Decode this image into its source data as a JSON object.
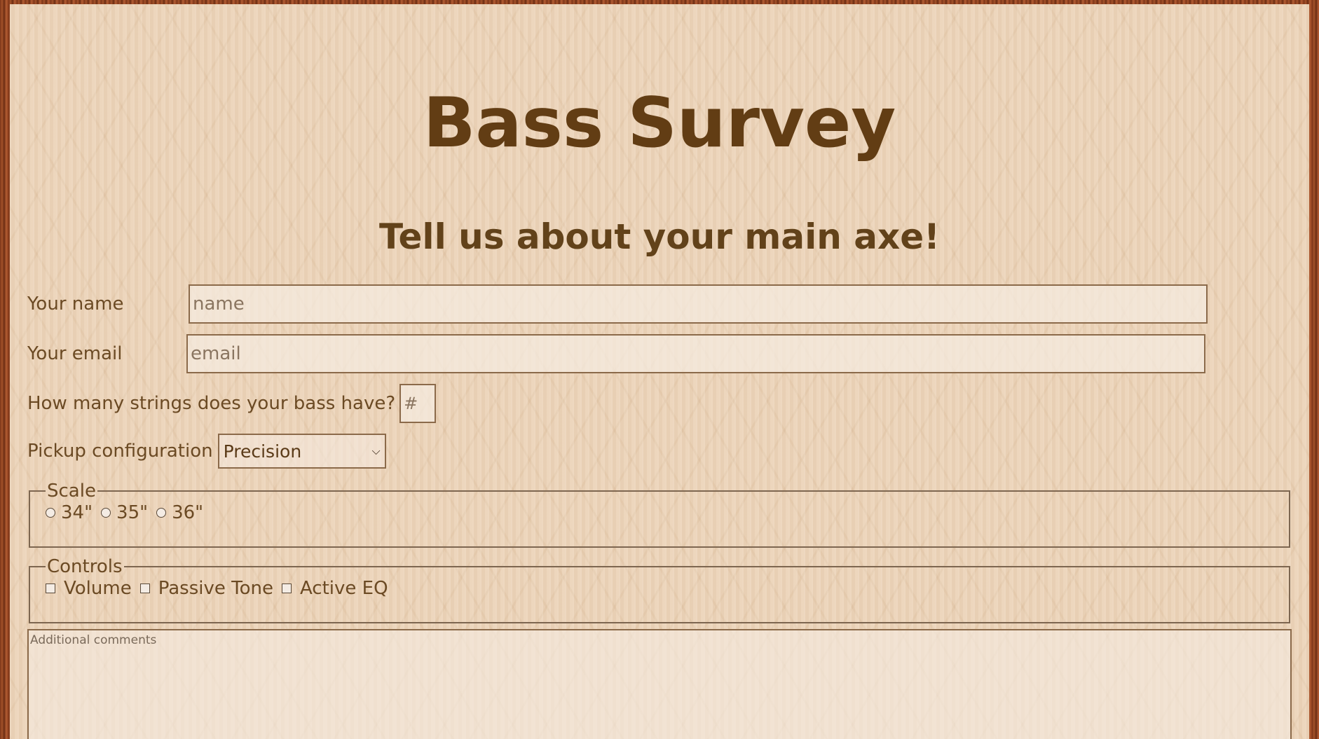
{
  "header": {
    "title": "Bass Survey",
    "subtitle": "Tell us about your main axe!"
  },
  "form": {
    "name": {
      "label": "Your name",
      "placeholder": "name",
      "value": ""
    },
    "email": {
      "label": "Your email",
      "placeholder": "email",
      "value": ""
    },
    "strings": {
      "label": "How many strings does your bass have?",
      "placeholder": "#",
      "value": ""
    },
    "pickup": {
      "label": "Pickup configuration",
      "selected": "Precision"
    },
    "scale": {
      "legend": "Scale",
      "options": [
        "34\"",
        "35\"",
        "36\""
      ]
    },
    "controls": {
      "legend": "Controls",
      "options": [
        "Volume",
        "Passive Tone",
        "Active EQ"
      ]
    },
    "comments": {
      "placeholder": "Additional comments",
      "value": ""
    }
  },
  "colors": {
    "title": "#623d14",
    "text": "#6b4a24",
    "border": "#8b6a4a",
    "background": "#ecd4b9"
  },
  "icons": {
    "select_arrow": "chevron-down-icon"
  }
}
